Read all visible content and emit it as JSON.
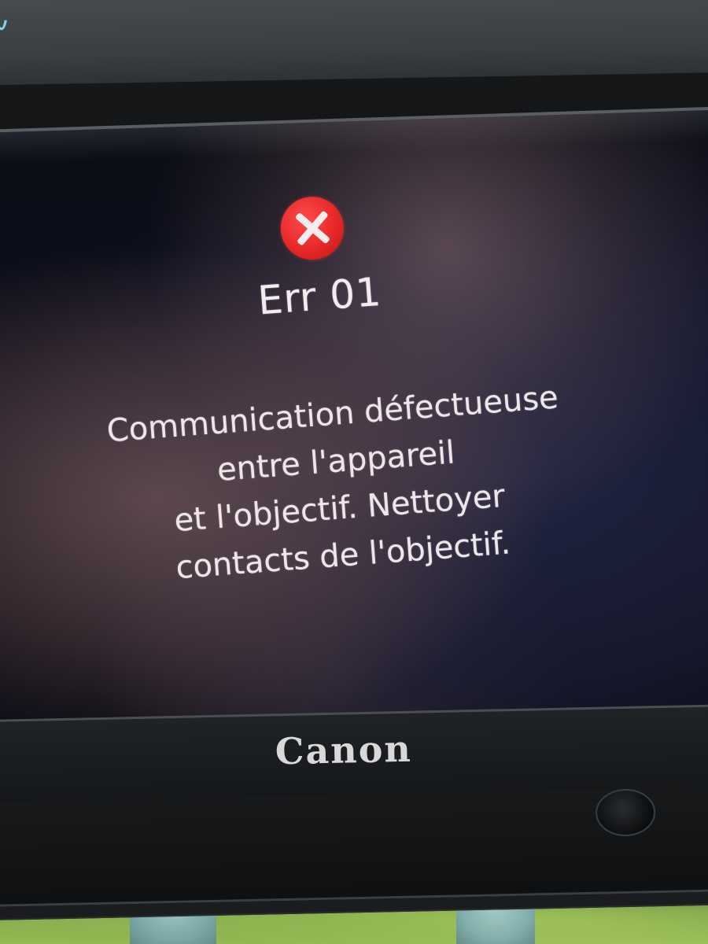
{
  "error": {
    "code": "Err 01",
    "message_lines": [
      "Communication défectueuse",
      "entre l'appareil",
      "et l'objectif. Nettoyer",
      "contacts de l'objectif."
    ],
    "icon": "error-x-icon",
    "icon_color": "#e32626"
  },
  "device": {
    "brand": "Canon"
  }
}
